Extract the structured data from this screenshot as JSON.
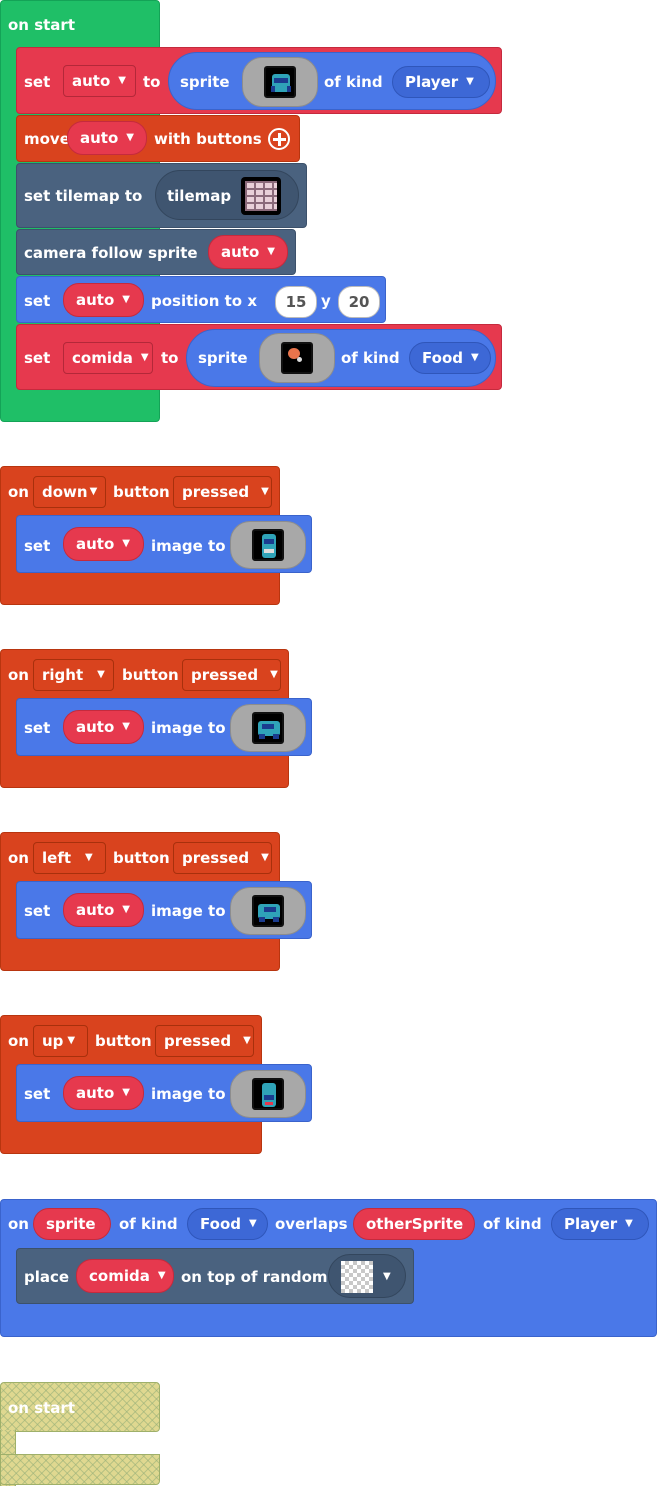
{
  "blocks": {
    "on_start_1": {
      "hat": "on start",
      "set1": {
        "set": "set",
        "var": "auto",
        "to": "to",
        "sprite": "sprite",
        "of_kind": "of kind",
        "kind": "Player"
      },
      "move": {
        "move": "move",
        "var": "auto",
        "with_buttons": "with buttons",
        "plus_icon": "plus-circle-icon"
      },
      "tilemap": {
        "label": "set tilemap to",
        "value": "tilemap"
      },
      "camera": {
        "label": "camera follow sprite",
        "var": "auto"
      },
      "position": {
        "set": "set",
        "var": "auto",
        "label": "position to x",
        "x": "15",
        "y_label": "y",
        "y": "20"
      },
      "set2": {
        "set": "set",
        "var": "comida",
        "to": "to",
        "sprite": "sprite",
        "of_kind": "of kind",
        "kind": "Food"
      }
    },
    "on_down": {
      "on": "on",
      "button": "down",
      "button_label": "button",
      "event": "pressed",
      "set": "set",
      "var": "auto",
      "image_to": "image to"
    },
    "on_right": {
      "on": "on",
      "button": "right",
      "button_label": "button",
      "event": "pressed",
      "set": "set",
      "var": "auto",
      "image_to": "image to"
    },
    "on_left": {
      "on": "on",
      "button": "left",
      "button_label": "button",
      "event": "pressed",
      "set": "set",
      "var": "auto",
      "image_to": "image to"
    },
    "on_up": {
      "on": "on",
      "button": "up",
      "button_label": "button",
      "event": "pressed",
      "set": "set",
      "var": "auto",
      "image_to": "image to"
    },
    "overlap": {
      "on": "on",
      "sprite": "sprite",
      "of_kind": "of kind",
      "kind1": "Food",
      "overlaps": "overlaps",
      "other": "otherSprite",
      "of_kind2": "of kind",
      "kind2": "Player",
      "place": "place",
      "var": "comida",
      "on_top": "on top of random"
    },
    "on_start_2": {
      "hat": "on start"
    }
  },
  "colors": {
    "events_green": "#1fbf67",
    "controller_red": "#d9431e",
    "sprites_blue": "#4a78e8",
    "variables_red": "#e6394e",
    "scene_slate": "#4a627f",
    "disabled_ghost": "#dfd890"
  }
}
